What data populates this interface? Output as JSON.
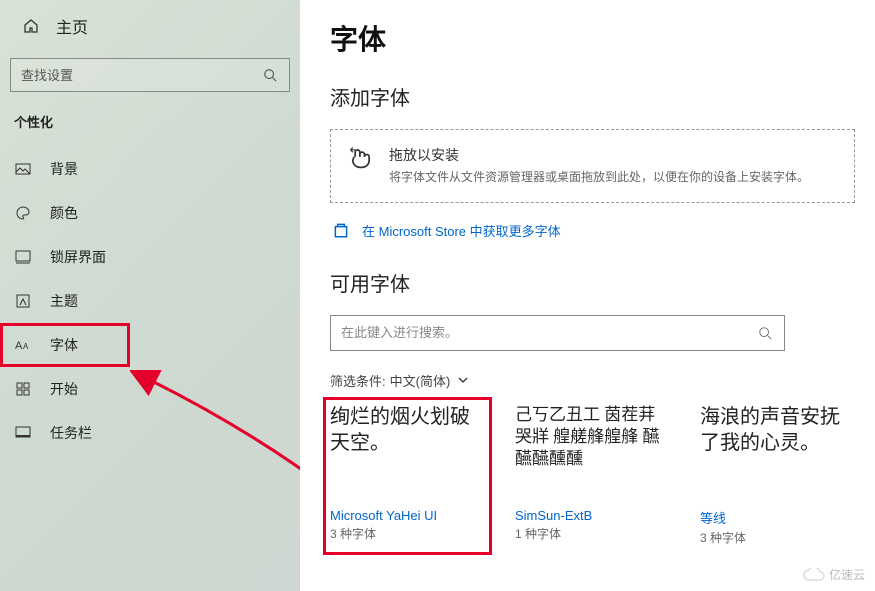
{
  "sidebar": {
    "home": "主页",
    "search_placeholder": "查找设置",
    "section": "个性化",
    "items": [
      {
        "label": "背景"
      },
      {
        "label": "颜色"
      },
      {
        "label": "锁屏界面"
      },
      {
        "label": "主题"
      },
      {
        "label": "字体"
      },
      {
        "label": "开始"
      },
      {
        "label": "任务栏"
      }
    ]
  },
  "main": {
    "title": "字体",
    "add_title": "添加字体",
    "drop_title": "拖放以安装",
    "drop_desc": "将字体文件从文件资源管理器或桌面拖放到此处，以便在你的设备上安装字体。",
    "store_link": "在 Microsoft Store 中获取更多字体",
    "available_title": "可用字体",
    "font_search_placeholder": "在此键入进行搜索。",
    "filter_label": "筛选条件:",
    "filter_value": "中文(简体)",
    "cards": [
      {
        "preview": "绚烂的烟火划破天空。",
        "name": "Microsoft YaHei UI",
        "count": "3 种字体"
      },
      {
        "preview": "己丂乙丑工 茵茬荓哭牂 艎艖艂艎艂 醼醼醼醺醺",
        "name": "SimSun-ExtB",
        "count": "1 种字体"
      },
      {
        "preview": "海浪的声音安抚了我的心灵。",
        "name": "等线",
        "count": "3 种字体"
      }
    ]
  },
  "watermark": "亿速云"
}
